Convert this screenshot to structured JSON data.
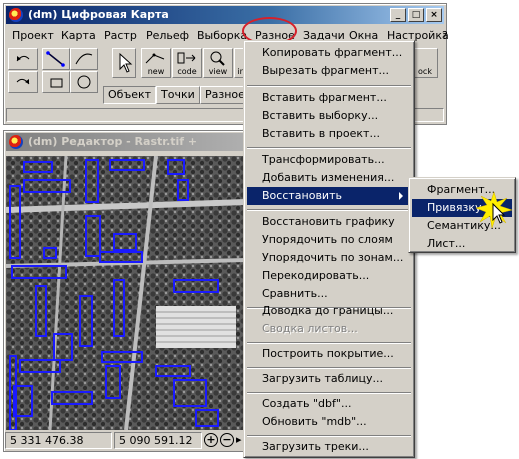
{
  "main_window": {
    "title": "(dm) Цифровая Карта",
    "menu": [
      "Проект",
      "Карта",
      "Растр",
      "Рельеф",
      "Выборка",
      "Разное",
      "Задачи",
      "Окна",
      "Настройка",
      "?"
    ],
    "toolbar": {
      "new_label": "new",
      "code_label": "code",
      "view_label": "view",
      "ins_label": "in",
      "lock_label": "ock"
    },
    "tabs": [
      "Объект",
      "Точки",
      "Разное"
    ]
  },
  "editor_window": {
    "title": "(dm) Редактор - Rastr.tif + d:\\maps\\t",
    "status": {
      "x": "5 331 476.38",
      "y": "5 090 591.12"
    }
  },
  "menu_razное": {
    "items": [
      {
        "label": "Копировать фрагмент...",
        "enabled": true
      },
      {
        "label": "Вырезать фрагмент...",
        "enabled": true
      },
      {
        "label": "Вставить фрагмент...",
        "enabled": true
      },
      {
        "label": "Вставить выборку...",
        "enabled": true
      },
      {
        "label": "Вставить в проект...",
        "enabled": true
      },
      {
        "label": "Трансформировать...",
        "enabled": true
      },
      {
        "label": "Добавить изменения...",
        "enabled": true
      },
      {
        "label": "Восстановить",
        "enabled": true,
        "highlighted": true
      },
      {
        "label": "Восстановить графику",
        "enabled": true
      },
      {
        "label": "Упорядочить по слоям",
        "enabled": true
      },
      {
        "label": "Упорядочить по зонам...",
        "enabled": true
      },
      {
        "label": "Перекодировать...",
        "enabled": true
      },
      {
        "label": "Сравнить...",
        "enabled": true
      },
      {
        "label": "Доводка до границы...",
        "enabled": true
      },
      {
        "label": "Сводка листов...",
        "enabled": false
      },
      {
        "label": "Построить покрытие...",
        "enabled": true
      },
      {
        "label": "Загрузить таблицу...",
        "enabled": true
      },
      {
        "label": "Создать \"dbf\"...",
        "enabled": true
      },
      {
        "label": "Обновить \"mdb\"...",
        "enabled": true
      },
      {
        "label": "Загрузить треки...",
        "enabled": true
      }
    ]
  },
  "submenu_restore": {
    "items": [
      "Фрагмент...",
      "Привязку...",
      "Семантику...",
      "Лист..."
    ],
    "highlighted": "Привязку..."
  },
  "colors": {
    "menu_highlight": "#0a246a",
    "circle": "#d6202a",
    "building_outline": "#1a1aff"
  }
}
